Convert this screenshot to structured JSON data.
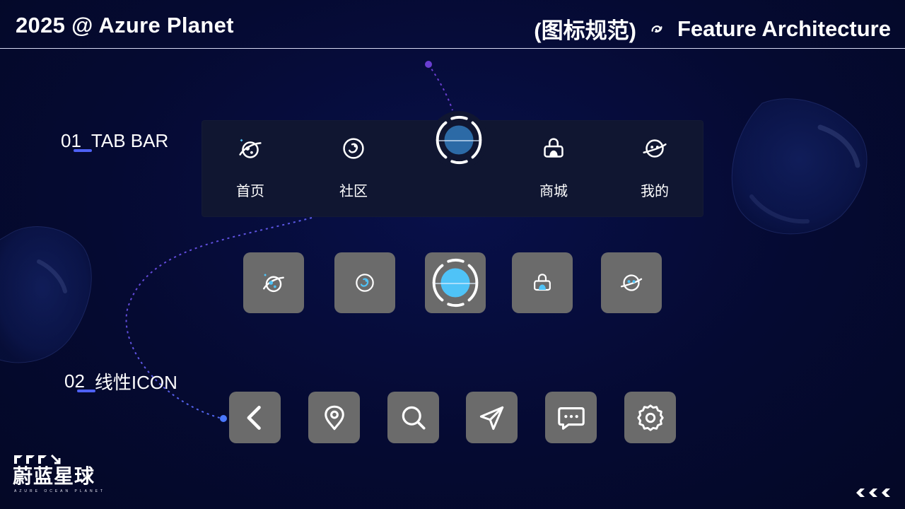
{
  "header": {
    "left_title": "2025 @ Azure Planet",
    "right_title_cn": "(图标规范)",
    "right_title_en": "Feature Architecture",
    "swirl_icon": "swirl-icon"
  },
  "sections": [
    {
      "number": "01",
      "title": "TAB BAR"
    },
    {
      "number": "02",
      "title": "线性ICON"
    }
  ],
  "tabbar": {
    "items": [
      {
        "label": "首页",
        "icon": "planet-home-icon"
      },
      {
        "label": "社区",
        "icon": "community-icon"
      },
      {
        "label": "",
        "icon": "center-planet-icon"
      },
      {
        "label": "商城",
        "icon": "shopping-bag-icon"
      },
      {
        "label": "我的",
        "icon": "profile-planet-icon"
      }
    ]
  },
  "filled_icons": [
    "planet-home-icon",
    "community-icon",
    "center-planet-icon",
    "shopping-bag-icon",
    "profile-planet-icon"
  ],
  "line_icons": [
    "back-arrow-icon",
    "location-pin-icon",
    "search-icon",
    "send-icon",
    "message-icon",
    "settings-gear-icon"
  ],
  "brand": {
    "name": "蔚蓝星球",
    "subtitle": "AZURE OCEAN PLANET"
  },
  "colors": {
    "background": "#050a2e",
    "accent_blue": "#4fc3f7",
    "accent_purple": "#6a4cff",
    "tile_gray": "#6b6b6b",
    "tabbar_bg": "#101631"
  }
}
